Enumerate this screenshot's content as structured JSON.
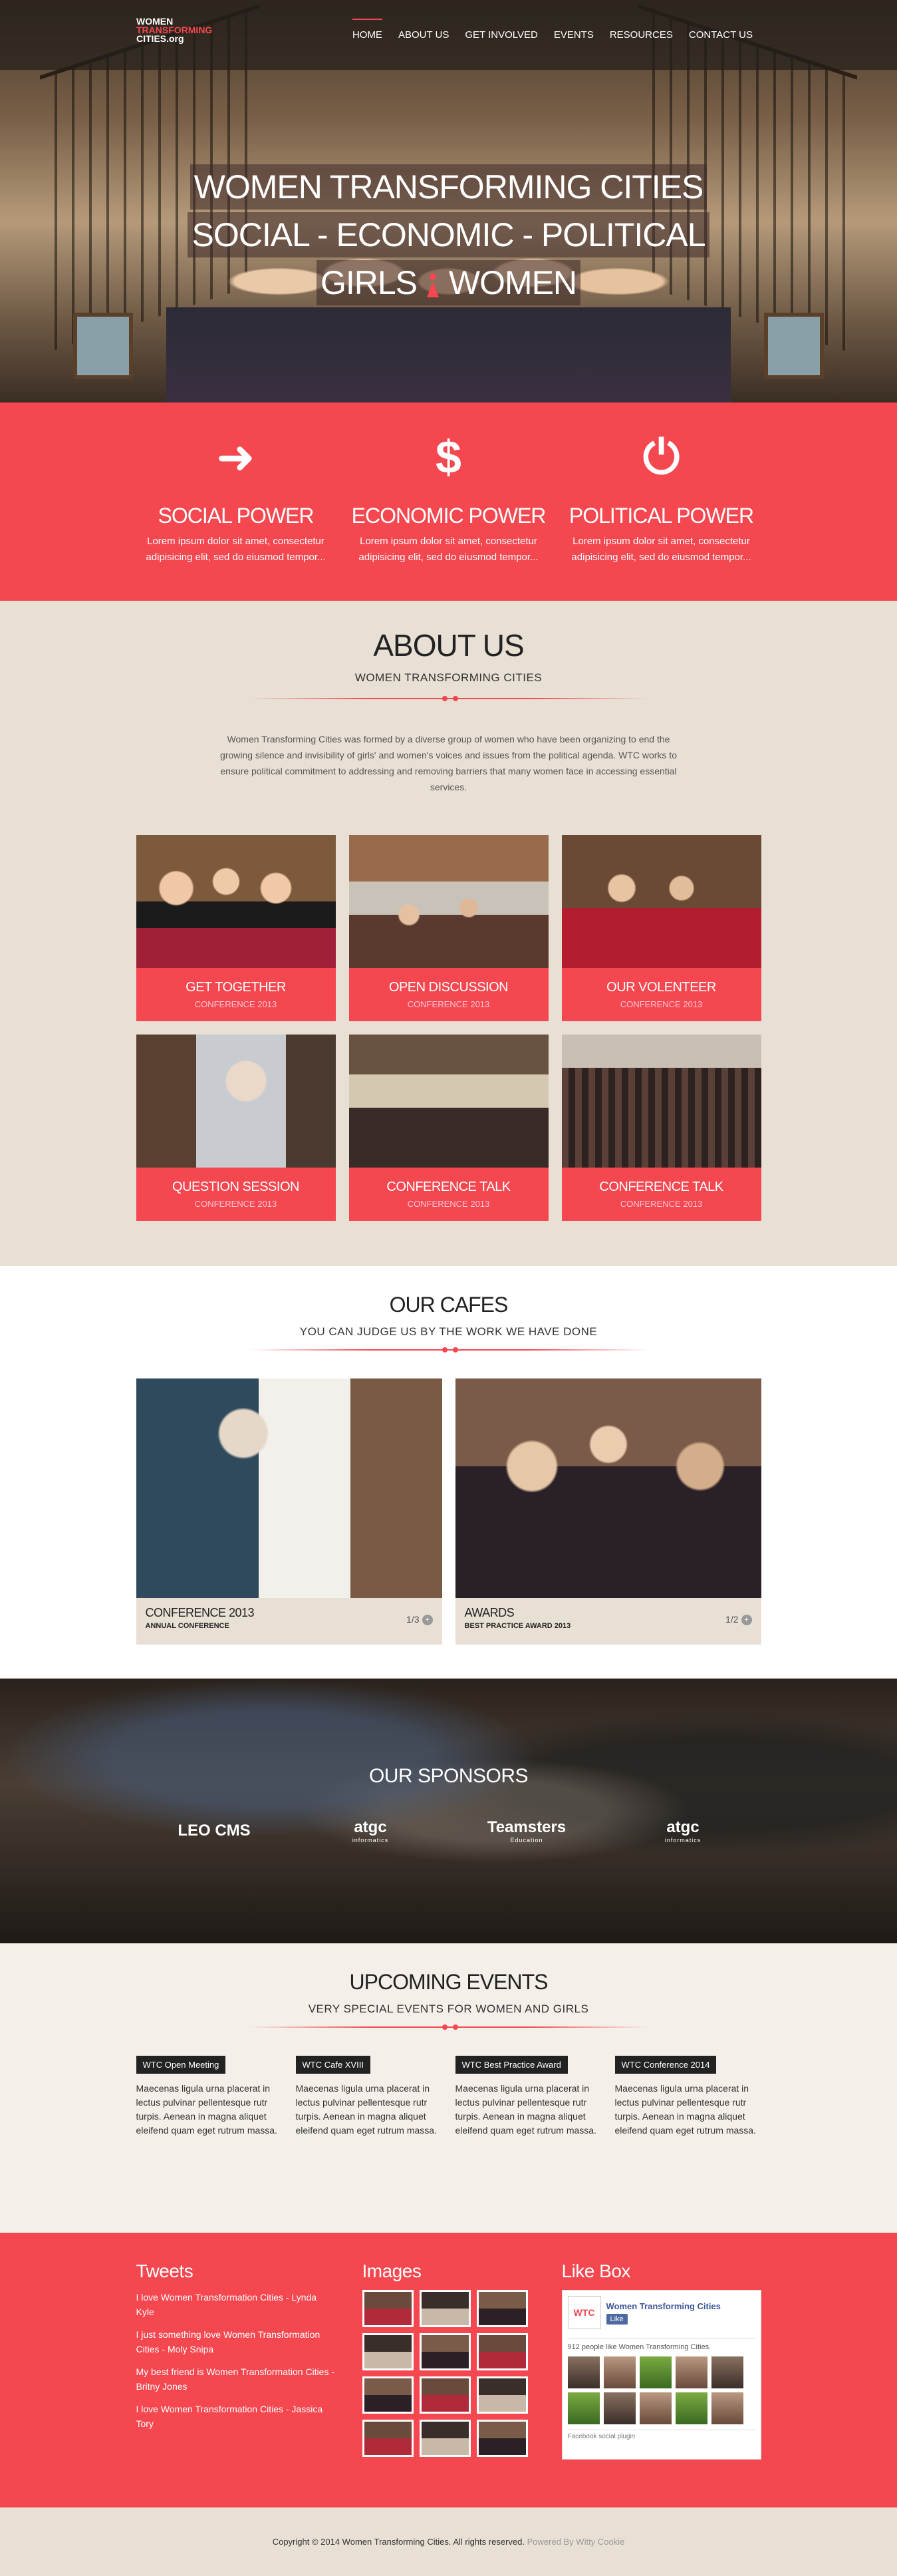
{
  "nav": {
    "logo": [
      "WOMEN",
      "TRANSFORMING",
      "CITIES.org"
    ],
    "items": [
      "HOME",
      "ABOUT US",
      "GET INVOLVED",
      "EVENTS",
      "RESOURCES",
      "CONTACT US"
    ]
  },
  "hero": {
    "line1": "WOMEN TRANSFORMING CITIES",
    "line2": "SOCIAL - ECONOMIC - POLITICAL",
    "line3a": "GIRLS",
    "line3b": "WOMEN"
  },
  "powers": [
    {
      "icon": "sign-in-icon",
      "glyph": "➜",
      "title": "SOCIAL POWER",
      "text": "Lorem ipsum dolor sit amet, consectetur adipisicing elit, sed do eiusmod tempor..."
    },
    {
      "icon": "dollar-icon",
      "glyph": "$",
      "title": "ECONOMIC POWER",
      "text": "Lorem ipsum dolor sit amet, consectetur adipisicing elit, sed do eiusmod tempor..."
    },
    {
      "icon": "power-icon",
      "glyph": "⏻",
      "title": "POLITICAL POWER",
      "text": "Lorem ipsum dolor sit amet, consectetur adipisicing elit, sed do eiusmod tempor..."
    }
  ],
  "about": {
    "title": "ABOUT US",
    "subtitle": "WOMEN TRANSFORMING CITIES",
    "desc": "Women Transforming Cities was formed by a diverse group of women who have been organizing to end the growing silence and invisibility of girls' and women's voices and issues from the political agenda. WTC works to ensure political commitment to addressing and removing barriers that many women face in accessing essential services.",
    "cards": [
      {
        "title": "GET TOGETHER",
        "sub": "CONFERENCE 2013"
      },
      {
        "title": "OPEN DISCUSSION",
        "sub": "CONFERENCE 2013"
      },
      {
        "title": "OUR VOLENTEER",
        "sub": "CONFERENCE 2013"
      },
      {
        "title": "QUESTION SESSION",
        "sub": "CONFERENCE 2013"
      },
      {
        "title": "CONFERENCE TALK",
        "sub": "CONFERENCE 2013"
      },
      {
        "title": "CONFERENCE TALK",
        "sub": "CONFERENCE 2013"
      }
    ]
  },
  "cafes": {
    "title": "OUR CAFES",
    "subtitle": "YOU CAN JUDGE US BY THE WORK WE HAVE DONE",
    "items": [
      {
        "title": "CONFERENCE 2013",
        "sub": "ANNUAL CONFERENCE",
        "count": "1/3"
      },
      {
        "title": "AWARDS",
        "sub": "BEST PRACTICE AWARD 2013",
        "count": "1/2"
      }
    ]
  },
  "sponsors": {
    "title": "OUR SPONSORS",
    "logos": [
      {
        "name": "LEO CMS",
        "sub": ""
      },
      {
        "name": "atgc",
        "sub": "informatics"
      },
      {
        "name": "Teamsters",
        "sub": "Education"
      },
      {
        "name": "atgc",
        "sub": "informatics"
      }
    ]
  },
  "events": {
    "title": "UPCOMING EVENTS",
    "subtitle": "VERY SPECIAL EVENTS FOR WOMEN AND GIRLS",
    "items": [
      {
        "tag": "WTC Open Meeting",
        "text": "Maecenas ligula urna placerat in lectus pulvinar pellentesque rutr turpis. Aenean in magna aliquet eleifend quam eget rutrum massa."
      },
      {
        "tag": "WTC Cafe XVIII",
        "text": "Maecenas ligula urna placerat in lectus pulvinar pellentesque rutr turpis. Aenean in magna aliquet eleifend quam eget rutrum massa."
      },
      {
        "tag": "WTC Best Practice Award",
        "text": "Maecenas ligula urna placerat in lectus pulvinar pellentesque rutr turpis. Aenean in magna aliquet eleifend quam eget rutrum massa."
      },
      {
        "tag": "WTC Conference 2014",
        "text": "Maecenas ligula urna placerat in lectus pulvinar pellentesque rutr turpis. Aenean in magna aliquet eleifend quam eget rutrum massa."
      }
    ]
  },
  "footer": {
    "tweets_title": "Tweets",
    "tweets": [
      "I love Women Transformation Cities - Lynda Kyle",
      "I just something love Women Transformation Cities - Moly Snipa",
      "My best friend is Women Transformation Cities - Britny Jones",
      "I love Women Transformation Cities - Jassica Tory"
    ],
    "images_title": "Images",
    "likebox_title": "Like Box",
    "likebox": {
      "logo": "WTC",
      "page_name": "Women Transforming Cities",
      "like_label": "Like",
      "count_text": "912 people like Women Transforming Cities.",
      "plugin_text": "Facebook social plugin"
    }
  },
  "copyright": {
    "text": "Copyright © 2014 Women Transforming Cities. All rights reserved.",
    "powered": "Powered By Witty Cookie"
  },
  "colors": {
    "accent": "#f4474f",
    "beige": "#e8e0d4",
    "dark": "#222222"
  }
}
